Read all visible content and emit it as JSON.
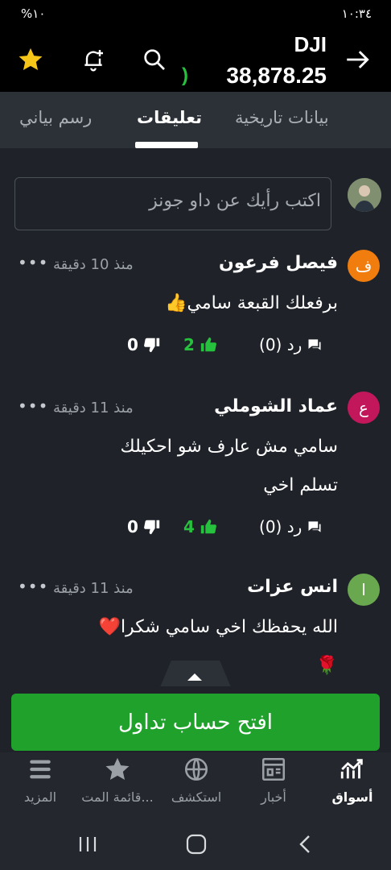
{
  "status_bar": {
    "left": "%١٠",
    "time": "١٠:٣٤"
  },
  "header": {
    "ticker": "DJI",
    "price": "38,878.25",
    "change_fragment": ")"
  },
  "tabs": [
    {
      "label": "رسم بياني",
      "active": false
    },
    {
      "label": "تعليقات",
      "active": true
    },
    {
      "label": "بيانات تاريخية",
      "active": false
    }
  ],
  "comment_box": {
    "placeholder": "اكتب رأيك عن داو جونز"
  },
  "comments": [
    {
      "avatar_letter": "ف",
      "avatar_color": "#f07d0e",
      "name": "فيصل فرعون",
      "time": "منذ 10 دقيقة",
      "lines": [
        "برفعلك القبعة سامي👍"
      ],
      "replies": "رد (0)",
      "likes": "2",
      "dislikes": "0"
    },
    {
      "avatar_letter": "ع",
      "avatar_color": "#c2185b",
      "name": "عماد الشوملي",
      "time": "منذ 11 دقيقة",
      "lines": [
        "سامي مش عارف شو احكيلك",
        "تسلم اخي"
      ],
      "replies": "رد (0)",
      "likes": "4",
      "dislikes": "0"
    },
    {
      "avatar_letter": "ا",
      "avatar_color": "#6aa84f",
      "name": "انس عزات",
      "time": "منذ 11 دقيقة",
      "lines": [
        "الله يحفظك اخي سامي شكرا❤️",
        "🌹"
      ]
    }
  ],
  "cta": {
    "label": "افتح حساب تداول"
  },
  "bottom_nav": [
    {
      "label": "أسواق",
      "icon": "markets-icon",
      "active": true
    },
    {
      "label": "أخبار",
      "icon": "news-icon",
      "active": false
    },
    {
      "label": "استكشف",
      "icon": "globe-icon",
      "active": false
    },
    {
      "label": "قائمة المت...",
      "icon": "star-icon",
      "active": false
    },
    {
      "label": "المزيد",
      "icon": "menu-icon",
      "active": false
    }
  ],
  "colors": {
    "accent_green": "#1fa12b",
    "positive": "#26c13d",
    "star": "#f5c518"
  }
}
